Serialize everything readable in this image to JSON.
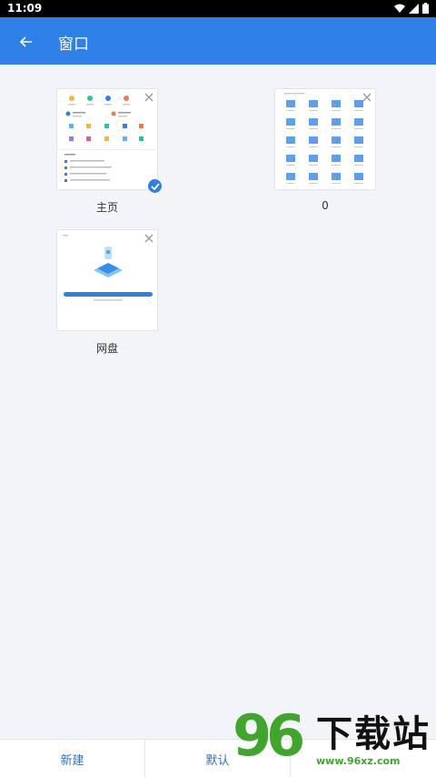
{
  "status_bar": {
    "time": "11:09"
  },
  "app_bar": {
    "title": "窗口"
  },
  "windows": [
    {
      "label": "主页",
      "selected": true
    },
    {
      "label": "0",
      "selected": false
    },
    {
      "label": "网盘",
      "selected": false
    }
  ],
  "bottom_bar": {
    "new_label": "新建",
    "default_label": "默认",
    "third_label": ""
  },
  "watermark": {
    "digits": "96",
    "name": "下载站",
    "url": "www.96xz.com"
  },
  "colors": {
    "accent": "#2f7fe8",
    "background": "#f3f4f8",
    "watermark_green": "#3fa52c"
  }
}
